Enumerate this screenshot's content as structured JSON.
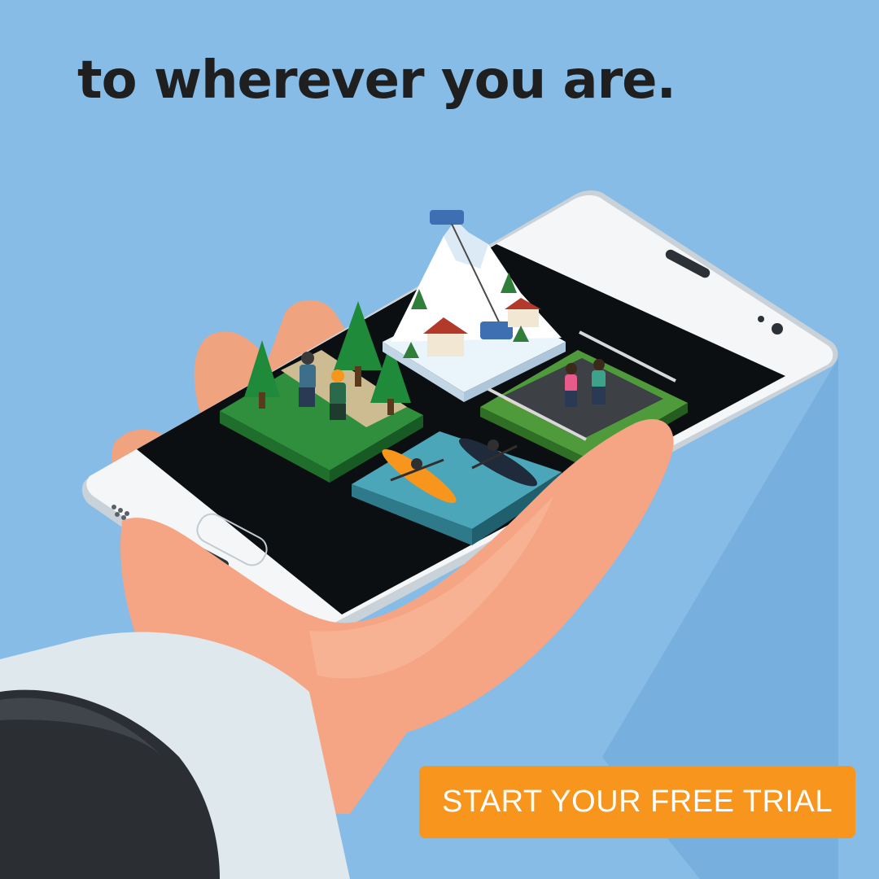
{
  "headline": "to wherever you are.",
  "cta": {
    "label": "START YOUR FREE TRIAL"
  },
  "colors": {
    "background": "#86bce6",
    "cta": "#f7951d",
    "headline": "#1f1f1f"
  },
  "illustration": {
    "icons": [
      "phone-icon",
      "hand-icon",
      "sleeve-icon",
      "forest-hiking-tile",
      "ski-mountain-tile",
      "kayak-water-tile",
      "running-road-tile"
    ]
  }
}
